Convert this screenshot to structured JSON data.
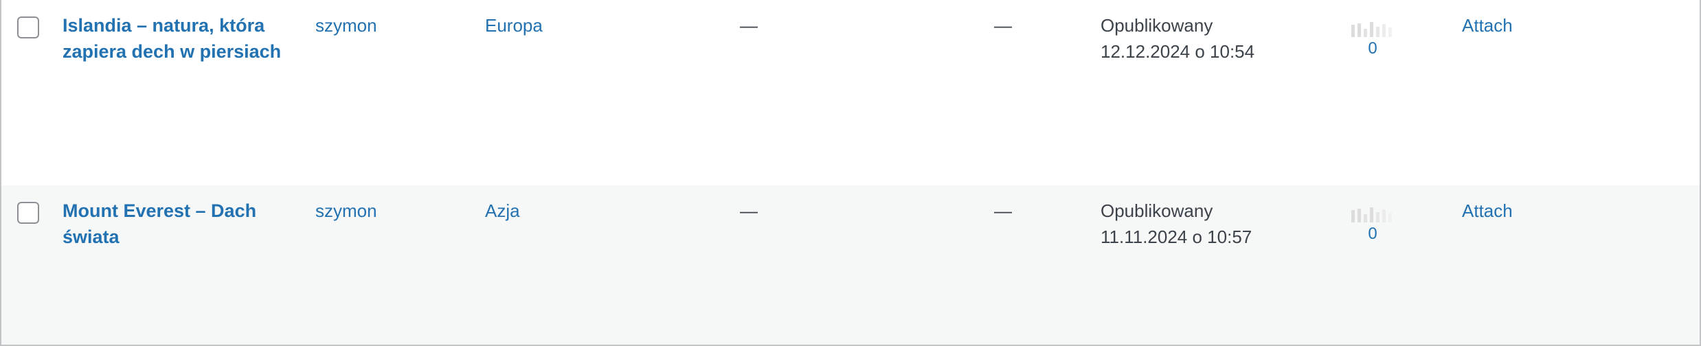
{
  "posts": [
    {
      "title": "Islandia – natura, która zapiera dech w piersiach",
      "author": "szymon",
      "category": "Europa",
      "tags": "—",
      "comments": "—",
      "status": "Opublikowany",
      "date": "12.12.2024 o 10:54",
      "stats_count": "0",
      "attach_label": "Attach"
    },
    {
      "title": "Mount Everest – Dach świata",
      "author": "szymon",
      "category": "Azja",
      "tags": "—",
      "comments": "—",
      "status": "Opublikowany",
      "date": "11.11.2024 o 10:57",
      "stats_count": "0",
      "attach_label": "Attach"
    }
  ],
  "icons": {
    "stats": "bar-chart-icon"
  },
  "colors": {
    "link": "#2271b1",
    "text": "#3c434a",
    "alt_row": "#f6f7f7",
    "border": "#c3c4c7"
  }
}
